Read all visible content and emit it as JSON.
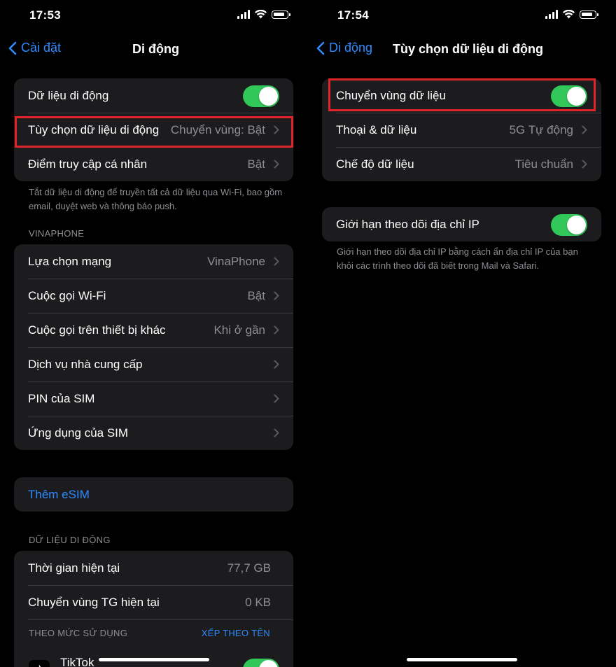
{
  "left": {
    "status": {
      "time": "17:53"
    },
    "nav": {
      "back_label": "Cài đặt",
      "title": "Di động"
    },
    "group1": {
      "mobile_data_label": "Dữ liệu di động",
      "mobile_data_on": true,
      "data_options_label": "Tùy chọn dữ liệu di động",
      "data_options_value": "Chuyển vùng: Bật",
      "hotspot_label": "Điểm truy cập cá nhân",
      "hotspot_value": "Bật"
    },
    "footnote": "Tắt dữ liệu di động để truyền tất cả dữ liệu qua Wi-Fi, bao gồm email, duyệt web và thông báo push.",
    "carrier_header": "VINAPHONE",
    "carrier_group": {
      "network_label": "Lựa chọn mạng",
      "network_value": "VinaPhone",
      "wifi_call_label": "Cuộc gọi Wi-Fi",
      "wifi_call_value": "Bật",
      "other_devices_label": "Cuộc gọi trên thiết bị khác",
      "other_devices_value": "Khi ở gần",
      "carrier_services_label": "Dịch vụ nhà cung cấp",
      "sim_pin_label": "PIN của SIM",
      "sim_apps_label": "Ứng dụng của SIM"
    },
    "esim": {
      "add_label": "Thêm eSIM"
    },
    "usage_header": "DỮ LIỆU DI ĐỘNG",
    "usage_group": {
      "current_period_label": "Thời gian hiện tại",
      "current_period_value": "77,7 GB",
      "roaming_period_label": "Chuyển vùng TG hiện tại",
      "roaming_period_value": "0 KB"
    },
    "by_usage_header": "THEO MỨC SỬ DỤNG",
    "sort_by_name": "XẾP THEO TÊN",
    "first_app": {
      "name": "TikTok",
      "enabled": true
    }
  },
  "right": {
    "status": {
      "time": "17:54"
    },
    "nav": {
      "back_label": "Di động",
      "title": "Tùy chọn dữ liệu di động"
    },
    "group1": {
      "roaming_label": "Chuyển vùng dữ liệu",
      "roaming_on": true,
      "voice_data_label": "Thoại & dữ liệu",
      "voice_data_value": "5G Tự động",
      "data_mode_label": "Chế độ dữ liệu",
      "data_mode_value": "Tiêu chuẩn"
    },
    "group2": {
      "limit_ip_label": "Giới hạn theo dõi địa chỉ IP",
      "limit_ip_on": true
    },
    "footnote": "Giới hạn theo dõi địa chỉ IP bằng cách ẩn địa chỉ IP của bạn khỏi các trình theo dõi đã biết trong Mail và Safari."
  },
  "colors": {
    "background": "#000000",
    "cell": "#1c1c1e",
    "accent_blue": "#2e8bff",
    "toggle_green": "#31c759",
    "highlight_red": "#e0242a",
    "secondary_text": "#8e8e93"
  }
}
